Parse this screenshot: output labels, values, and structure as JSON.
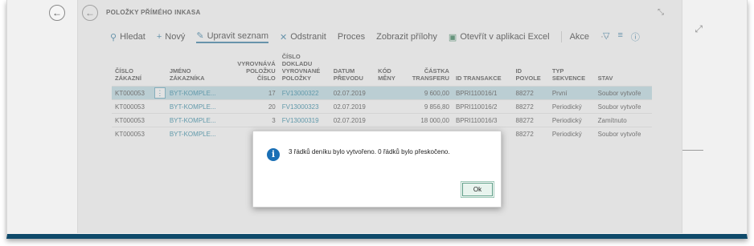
{
  "outer": {
    "back_icon": "arrow-left-icon",
    "expand_icon": "expand-icon"
  },
  "header": {
    "title": "POLOŽKY PŘÍMÉHO INKASA",
    "collapse_icon": "collapse-icon"
  },
  "toolbar": {
    "search": "Hledat",
    "new": "Nový",
    "edit_list": "Upravit seznam",
    "delete": "Odstranit",
    "process": "Proces",
    "attachments": "Zobrazit přílohy",
    "open_excel": "Otevřít v aplikaci Excel",
    "actions": "Akce",
    "more": "···",
    "filter_icon": "filter-icon",
    "list_icon": "list-icon",
    "info_icon": "info-icon"
  },
  "columns": {
    "customer_no": [
      "ČÍSLO",
      "ZÁKAZNÍ"
    ],
    "customer_name": [
      "JMÉNO",
      "ZÁKAZNÍKA"
    ],
    "applied_no": [
      "VYROVNÁVÁ",
      "POLOŽKU",
      "ČÍSLO"
    ],
    "doc_no": [
      "ČÍSLO",
      "DOKLADU",
      "VYROVNANÉ",
      "POLOŽKY"
    ],
    "transfer_date": [
      "DATUM",
      "PŘEVODU"
    ],
    "currency": [
      "KÓD",
      "MĚNY"
    ],
    "amount": [
      "ČÁSTKA",
      "TRANSFERU"
    ],
    "transaction_id": [
      "ID TRANSAKCE"
    ],
    "mandate_id": [
      "ID",
      "POVOLE"
    ],
    "sequence_type": [
      "TYP",
      "SEKVENCE"
    ],
    "status": [
      "STAV"
    ]
  },
  "rows": [
    {
      "customer_no": "KT000053",
      "customer_name": "BYT-KOMPLE...",
      "applied_no": "17",
      "doc_no": "FV13000322",
      "transfer_date": "02.07.2019",
      "currency": "",
      "amount": "9 600,00",
      "transaction_id": "BPRI110016/1",
      "mandate_id": "88272",
      "sequence_type": "První",
      "status": "Soubor vytvoře"
    },
    {
      "customer_no": "KT000053",
      "customer_name": "BYT-KOMPLE...",
      "applied_no": "20",
      "doc_no": "FV13000323",
      "transfer_date": "02.07.2019",
      "currency": "",
      "amount": "9 856,80",
      "transaction_id": "BPRI110016/2",
      "mandate_id": "88272",
      "sequence_type": "Periodický",
      "status": "Soubor vytvoře"
    },
    {
      "customer_no": "KT000053",
      "customer_name": "BYT-KOMPLE...",
      "applied_no": "3",
      "doc_no": "FV13000319",
      "transfer_date": "02.07.2019",
      "currency": "",
      "amount": "18 000,00",
      "transaction_id": "BPRI110016/3",
      "mandate_id": "88272",
      "sequence_type": "Periodický",
      "status": "Zamítnuto"
    },
    {
      "customer_no": "KT000053",
      "customer_name": "BYT-KOMPLE...",
      "applied_no": "",
      "doc_no": "",
      "transfer_date": "",
      "currency": "",
      "amount": "",
      "transaction_id": "",
      "mandate_id": "88272",
      "sequence_type": "Periodický",
      "status": "Soubor vytvoře"
    }
  ],
  "row_menu": "⋮",
  "dialog": {
    "message": "3 řádků deníku bylo vytvořeno. 0 řádků bylo přeskočeno.",
    "ok_label": "Ok",
    "icon": "info-icon"
  },
  "colors": {
    "accent": "#1f6f9b",
    "selected_row": "#b9dbe4",
    "frame_bottom": "#0f4a6a",
    "info": "#1a6fb5"
  }
}
